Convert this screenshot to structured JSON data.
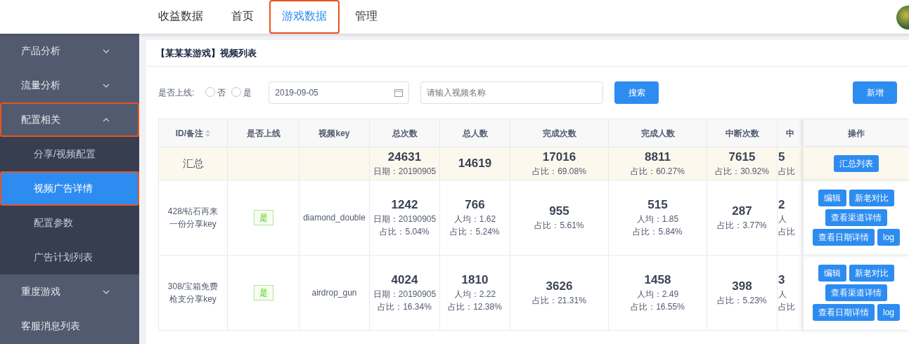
{
  "top_nav": {
    "tabs": [
      {
        "label": "收益数据",
        "selected": false,
        "highlighted": false
      },
      {
        "label": "首页",
        "selected": false,
        "highlighted": false
      },
      {
        "label": "游戏数据",
        "selected": true,
        "highlighted": true
      },
      {
        "label": "管理",
        "selected": false,
        "highlighted": false
      }
    ]
  },
  "sidebar": {
    "items": [
      {
        "label": "产品分析",
        "kind": "group",
        "expanded": false,
        "highlighted": false
      },
      {
        "label": "流量分析",
        "kind": "group",
        "expanded": false,
        "highlighted": false
      },
      {
        "label": "配置相关",
        "kind": "group",
        "expanded": true,
        "highlighted": true,
        "children": [
          {
            "label": "分享/视频配置",
            "selected": false,
            "highlighted": false
          },
          {
            "label": "视频广告详情",
            "selected": true,
            "highlighted": true
          },
          {
            "label": "配置参数",
            "selected": false,
            "highlighted": false
          },
          {
            "label": "广告计划列表",
            "selected": false,
            "highlighted": false
          }
        ]
      },
      {
        "label": "重度游戏",
        "kind": "group",
        "expanded": false,
        "highlighted": false
      },
      {
        "label": "客服消息列表",
        "kind": "link",
        "highlighted": false
      }
    ]
  },
  "card": {
    "title": "【某某某游戏】视频列表",
    "filters": {
      "online_label": "是否上线:",
      "radios": [
        {
          "label": "否",
          "checked": false
        },
        {
          "label": "是",
          "checked": false
        }
      ],
      "date": "2019-09-05",
      "search_placeholder": "请输入视频名称",
      "search_button": "搜索",
      "add_button": "新增"
    },
    "table": {
      "columns": [
        "ID/备注",
        "是否上线",
        "视频key",
        "总次数",
        "总人数",
        "完成次数",
        "完成人数",
        "中断次数",
        "中",
        "操作"
      ],
      "rows": [
        {
          "kind": "summary",
          "id_note": "汇总",
          "stats": [
            {
              "value": "24631",
              "lines": [
                "日期：20190905"
              ]
            },
            {
              "value": "14619"
            },
            {
              "value": "17016",
              "lines": [
                "占比：69.08%"
              ]
            },
            {
              "value": "8811",
              "lines": [
                "占比：60.27%"
              ]
            },
            {
              "value": "7615",
              "lines": [
                "占比：30.92%"
              ]
            },
            {
              "value": "5",
              "lines": [
                "占比"
              ]
            }
          ],
          "actions": [
            "汇总列表"
          ]
        },
        {
          "kind": "item",
          "id_note": "428/钻石再来一份分享key",
          "online": "是",
          "video_key": "diamond_double",
          "stats": [
            {
              "value": "1242",
              "lines": [
                "日期：20190905",
                "占比：5.04%"
              ]
            },
            {
              "value": "766",
              "lines": [
                "人均：1.62",
                "占比：5.24%"
              ]
            },
            {
              "value": "955",
              "lines": [
                "占比：5.61%"
              ]
            },
            {
              "value": "515",
              "lines": [
                "人均：1.85",
                "占比：5.84%"
              ]
            },
            {
              "value": "287",
              "lines": [
                "占比：3.77%"
              ]
            },
            {
              "value": "2",
              "lines": [
                "人",
                "占比"
              ]
            }
          ],
          "actions": [
            "编辑",
            "新老对比",
            "查看渠道详情",
            "查看日期详情",
            "log"
          ]
        },
        {
          "kind": "item",
          "id_note": "308/宝箱免费枪支分享key",
          "online": "是",
          "video_key": "airdrop_gun",
          "stats": [
            {
              "value": "4024",
              "lines": [
                "日期：20190905",
                "占比：16.34%"
              ]
            },
            {
              "value": "1810",
              "lines": [
                "人均：2.22",
                "占比：12.38%"
              ]
            },
            {
              "value": "3626",
              "lines": [
                "占比：21.31%"
              ]
            },
            {
              "value": "1458",
              "lines": [
                "人均：2.49",
                "占比：16.55%"
              ]
            },
            {
              "value": "398",
              "lines": [
                "占比：5.23%"
              ]
            },
            {
              "value": "3",
              "lines": [
                "人",
                "占比"
              ]
            }
          ],
          "actions": [
            "编辑",
            "新老对比",
            "查看渠道详情",
            "查看日期详情",
            "log"
          ]
        }
      ]
    }
  }
}
